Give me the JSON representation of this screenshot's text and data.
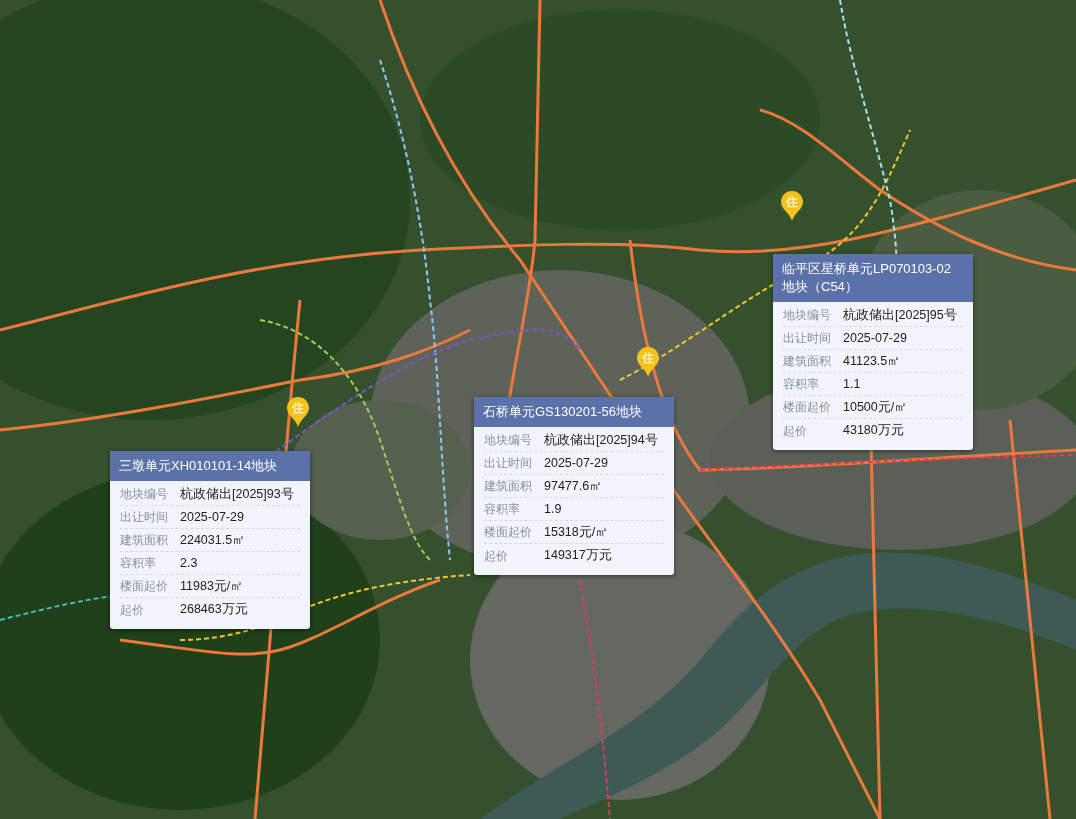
{
  "markers": [
    {
      "label": "住"
    },
    {
      "label": "住"
    },
    {
      "label": "住"
    }
  ],
  "popups": [
    {
      "title": "临平区星桥单元LP070103-02 地块（C54）",
      "fields": [
        {
          "label": "地块编号",
          "value": "杭政储出[2025]95号"
        },
        {
          "label": "出让时间",
          "value": "2025-07-29"
        },
        {
          "label": "建筑面积",
          "value": "41123.5㎡"
        },
        {
          "label": "容积率",
          "value": "1.1"
        },
        {
          "label": "楼面起价",
          "value": "10500元/㎡"
        },
        {
          "label": "起价",
          "value": "43180万元"
        }
      ]
    },
    {
      "title": "石桥单元GS130201-56地块",
      "fields": [
        {
          "label": "地块编号",
          "value": "杭政储出[2025]94号"
        },
        {
          "label": "出让时间",
          "value": "2025-07-29"
        },
        {
          "label": "建筑面积",
          "value": "97477.6㎡"
        },
        {
          "label": "容积率",
          "value": "1.9"
        },
        {
          "label": "楼面起价",
          "value": "15318元/㎡"
        },
        {
          "label": "起价",
          "value": "149317万元"
        }
      ]
    },
    {
      "title": "三墩单元XH010101-14地块",
      "fields": [
        {
          "label": "地块编号",
          "value": "杭政储出[2025]93号"
        },
        {
          "label": "出让时间",
          "value": "2025-07-29"
        },
        {
          "label": "建筑面积",
          "value": "224031.5㎡"
        },
        {
          "label": "容积率",
          "value": "2.3"
        },
        {
          "label": "楼面起价",
          "value": "11983元/㎡"
        },
        {
          "label": "起价",
          "value": "268463万元"
        }
      ]
    }
  ]
}
